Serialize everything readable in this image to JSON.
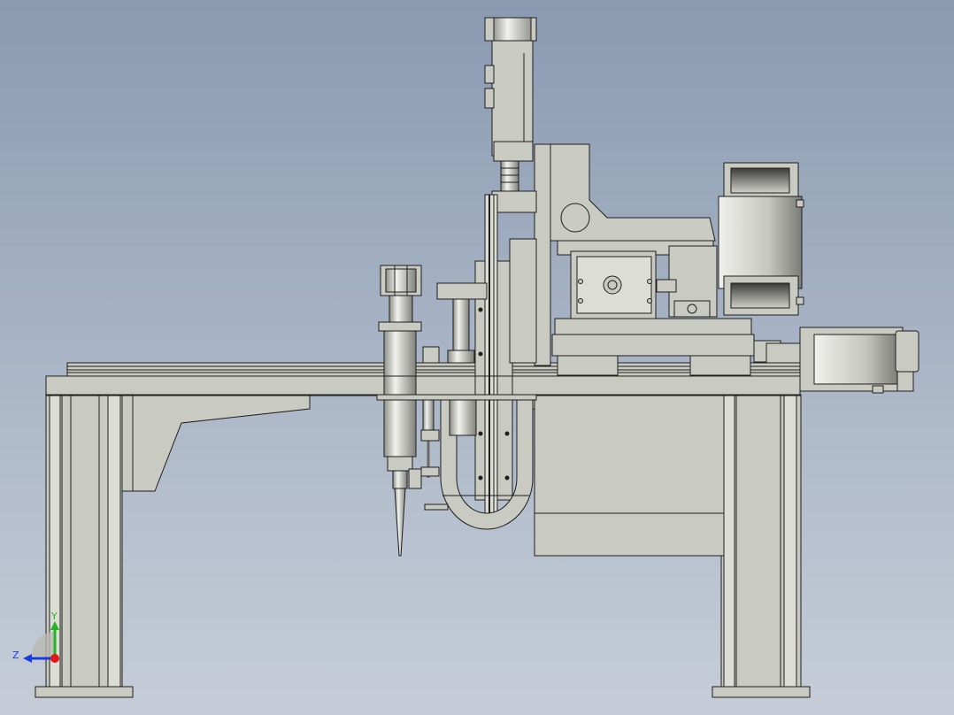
{
  "viewport": {
    "background_top": "#8a9ab1",
    "background_bottom": "#c6cdd8",
    "part_fill": "#c9cbc2",
    "part_dark": "#a7a99f",
    "edge_color": "#1e1e1e"
  },
  "triad": {
    "y_label": "Y",
    "z_label": "Z",
    "y_color": "#22b422",
    "z_color": "#1a3cdc",
    "x_color": "#e01818"
  }
}
